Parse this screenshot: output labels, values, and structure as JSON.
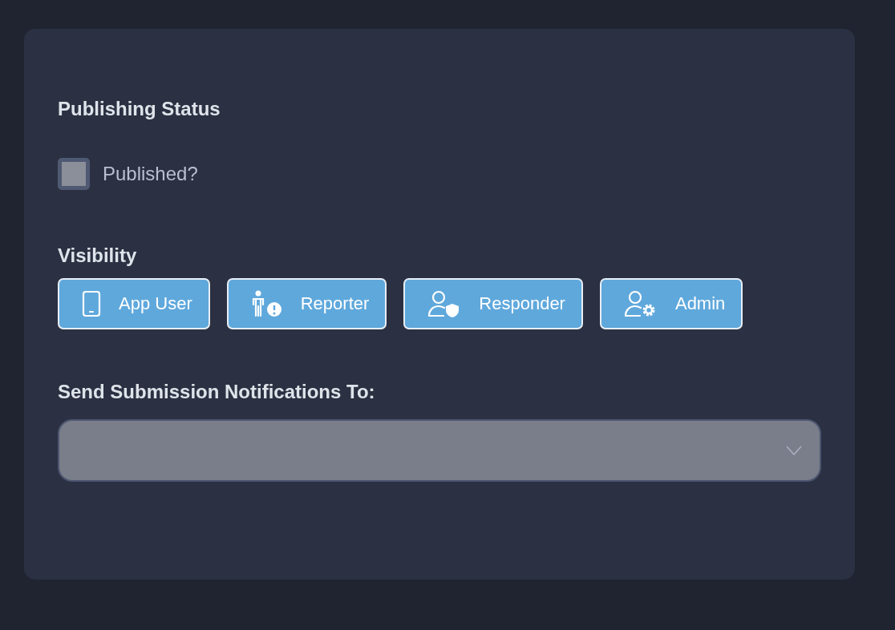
{
  "publishing": {
    "title": "Publishing Status",
    "checkbox": {
      "label": "Published?",
      "checked": false
    }
  },
  "visibility": {
    "title": "Visibility",
    "roles": [
      {
        "label": "App User",
        "kind": "phone",
        "selected": true
      },
      {
        "label": "Reporter",
        "kind": "reporter",
        "selected": true
      },
      {
        "label": "Responder",
        "kind": "responder",
        "selected": true
      },
      {
        "label": "Admin",
        "kind": "admin",
        "selected": true
      }
    ]
  },
  "notifications": {
    "title": "Send Submission Notifications To:",
    "select": {
      "expanded": false
    }
  }
}
